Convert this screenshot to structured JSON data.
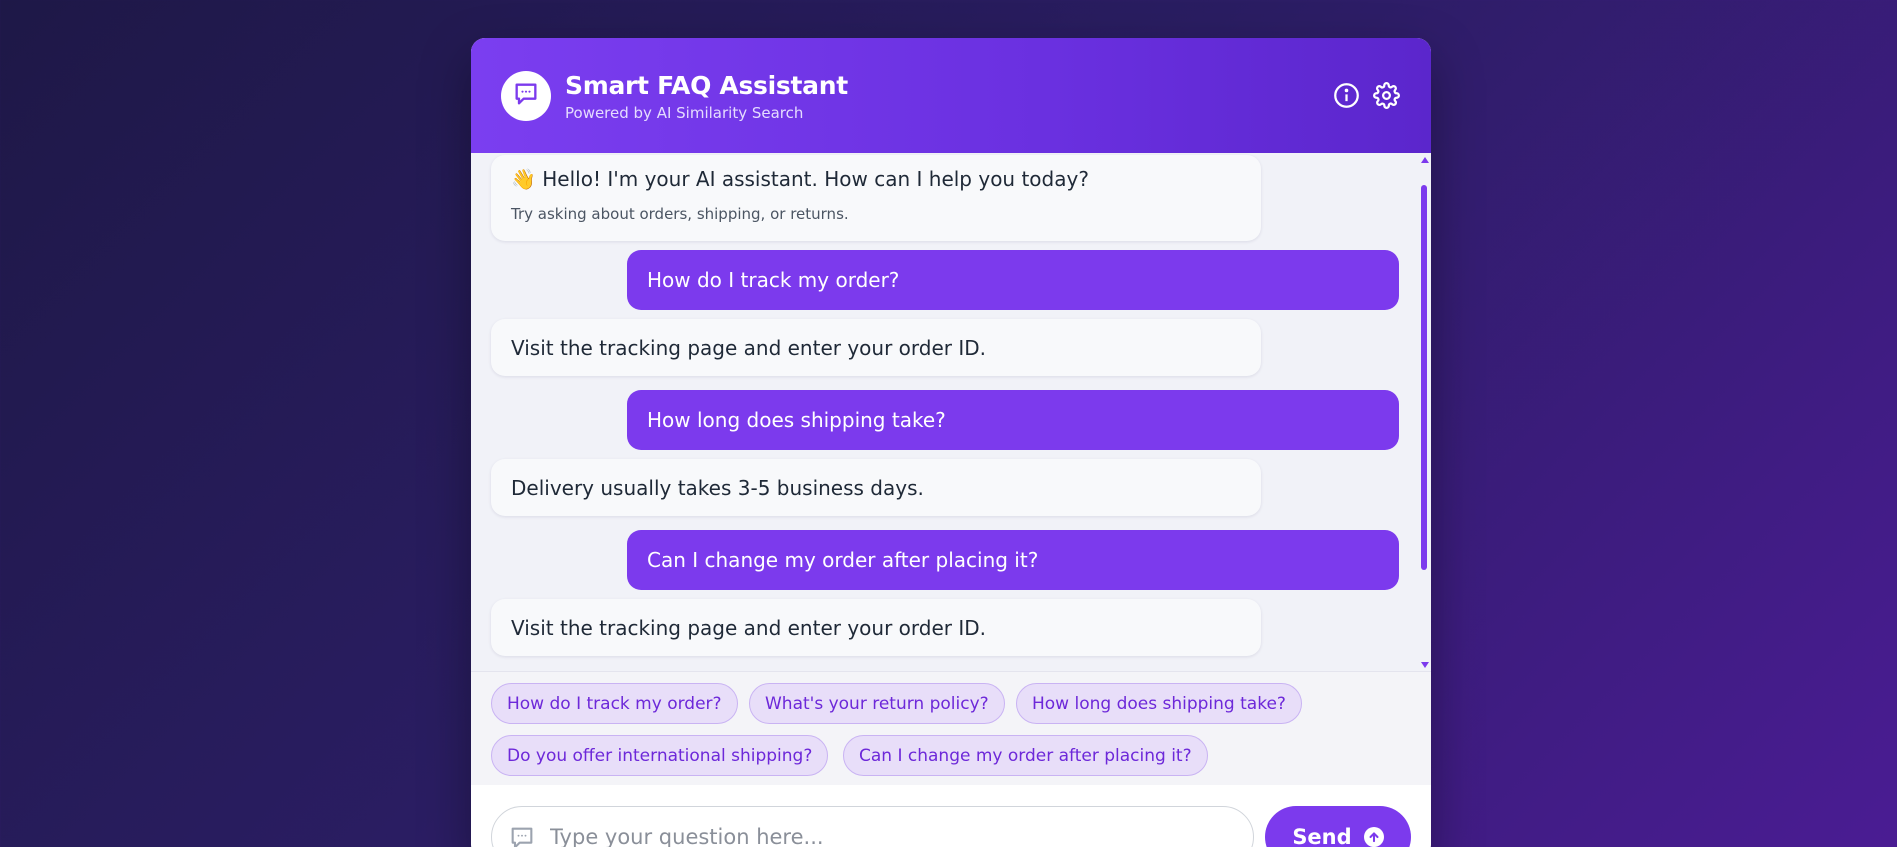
{
  "header": {
    "title": "Smart FAQ Assistant",
    "subtitle": "Powered by AI Similarity Search",
    "icons": [
      "chat-icon",
      "info-icon",
      "gear-icon"
    ]
  },
  "messages": {
    "welcome": {
      "text": "👋 Hello! I'm your AI assistant. How can I help you today?",
      "hint": "Try asking about orders, shipping, or returns."
    },
    "items": [
      {
        "from": "user",
        "text": "How do I track my order?"
      },
      {
        "from": "bot",
        "text": "Visit the tracking page and enter your order ID."
      },
      {
        "from": "user",
        "text": "How long does shipping take?"
      },
      {
        "from": "bot",
        "text": "Delivery usually takes 3-5 business days."
      },
      {
        "from": "user",
        "text": "Can I change my order after placing it?"
      },
      {
        "from": "bot",
        "text": "Visit the tracking page and enter your order ID."
      }
    ]
  },
  "suggestions": [
    "How do I track my order?",
    "What's your return policy?",
    "How long does shipping take?",
    "Do you offer international shipping?",
    "Can I change my order after placing it?"
  ],
  "input": {
    "placeholder": "Type your question here...",
    "value": ""
  },
  "send": {
    "label": "Send"
  },
  "colors": {
    "accent": "#7c3aed",
    "header_start": "#7b3ef0",
    "header_end": "#5b26cc",
    "chip_bg": "#e8def9",
    "chip_text": "#6d28d9"
  }
}
